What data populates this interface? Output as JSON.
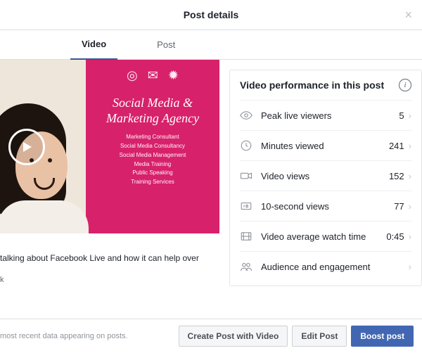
{
  "header": {
    "title": "Post details"
  },
  "tabs": {
    "video": "Video",
    "post": "Post"
  },
  "video_preview": {
    "banner_title": "Social Media &\nMarketing Agency",
    "banner_lines": [
      "Marketing Consultant",
      "Social Media Consultancy",
      "Social Media Management",
      "Media Training",
      "Public Speaking",
      "Training Services"
    ],
    "caption": "talking about Facebook Live and how it can help over",
    "meta_trail": "k"
  },
  "perf": {
    "title": "Video performance in this post",
    "rows": [
      {
        "icon": "eye",
        "label": "Peak live viewers",
        "value": "5"
      },
      {
        "icon": "clock",
        "label": "Minutes viewed",
        "value": "241"
      },
      {
        "icon": "camera",
        "label": "Video views",
        "value": "152"
      },
      {
        "icon": "ten",
        "label": "10-second views",
        "value": "77"
      },
      {
        "icon": "film",
        "label": "Video average watch time",
        "value": "0:45"
      },
      {
        "icon": "people",
        "label": "Audience and engagement",
        "value": ""
      }
    ]
  },
  "footer": {
    "note": "most recent data appearing on posts.",
    "create": "Create Post with Video",
    "edit": "Edit Post",
    "boost": "Boost post"
  }
}
